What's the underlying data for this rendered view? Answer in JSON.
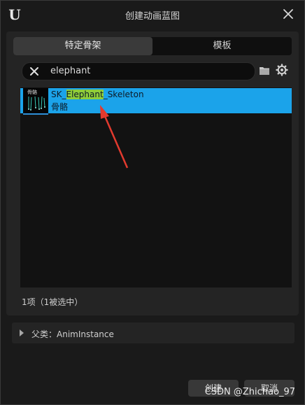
{
  "window": {
    "title": "创建动画蓝图",
    "logo": "U"
  },
  "tabs": [
    {
      "label": "特定骨架",
      "active": true
    },
    {
      "label": "模板",
      "active": false
    }
  ],
  "search": {
    "value": "elephant"
  },
  "results": [
    {
      "thumb_label": "骨骼",
      "name_prefix": "SK_",
      "name_highlight": "Elephant",
      "name_suffix": "_Skeleton",
      "type": "骨骼"
    }
  ],
  "status": "1项（1被选中）",
  "parent_class": {
    "label": "父类：AnimInstance"
  },
  "buttons": {
    "create": "创建",
    "cancel": "取消"
  },
  "watermark": "CSDN @Zhichao_97",
  "colors": {
    "selection": "#1ba3ea",
    "highlight": "#8fce3a",
    "arrow": "#e23a2e"
  }
}
